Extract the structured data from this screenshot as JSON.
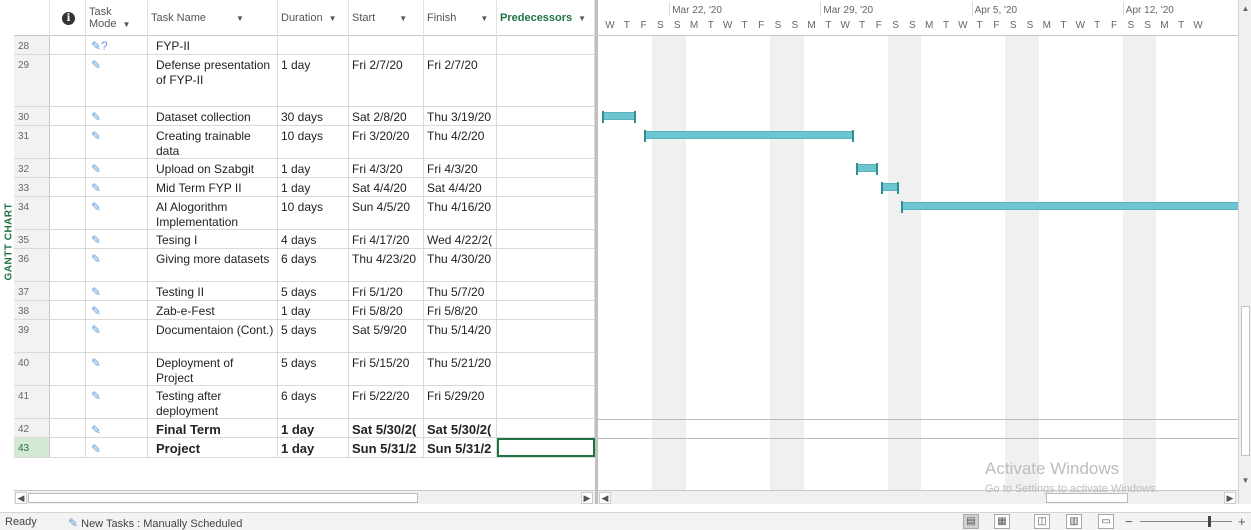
{
  "view": {
    "label": "GANTT CHART"
  },
  "columns": {
    "info_icon": "i",
    "mode_line1": "Task",
    "mode_line2": "Mode",
    "task_name": "Task Name",
    "duration": "Duration",
    "start": "Start",
    "finish": "Finish",
    "predecessors": "Predecessors"
  },
  "tasks": [
    {
      "id": "28",
      "name": "FYP-II",
      "duration": "",
      "start": "",
      "finish": "",
      "predecessors": ""
    },
    {
      "id": "29",
      "name": "Defense presentation of FYP-II",
      "duration": "1 day",
      "start": "Fri 2/7/20",
      "finish": "Fri 2/7/20",
      "predecessors": ""
    },
    {
      "id": "30",
      "name": "Dataset collection",
      "duration": "30 days",
      "start": "Sat 2/8/20",
      "finish": "Thu 3/19/20",
      "predecessors": ""
    },
    {
      "id": "31",
      "name": "Creating trainable data",
      "duration": "10 days",
      "start": "Fri 3/20/20",
      "finish": "Thu 4/2/20",
      "predecessors": ""
    },
    {
      "id": "32",
      "name": "Upload on Szabgit",
      "duration": "1 day",
      "start": "Fri 4/3/20",
      "finish": "Fri 4/3/20",
      "predecessors": ""
    },
    {
      "id": "33",
      "name": "Mid Term FYP II",
      "duration": "1 day",
      "start": "Sat 4/4/20",
      "finish": "Sat 4/4/20",
      "predecessors": ""
    },
    {
      "id": "34",
      "name": "AI Alogorithm Implementation",
      "duration": "10 days",
      "start": "Sun 4/5/20",
      "finish": "Thu 4/16/20",
      "predecessors": ""
    },
    {
      "id": "35",
      "name": "Tesing I",
      "duration": "4 days",
      "start": "Fri 4/17/20",
      "finish": "Wed 4/22/2(",
      "predecessors": ""
    },
    {
      "id": "36",
      "name": "Giving more datasets",
      "duration": "6 days",
      "start": "Thu 4/23/20",
      "finish": "Thu 4/30/20",
      "predecessors": ""
    },
    {
      "id": "37",
      "name": "Testing II",
      "duration": "5 days",
      "start": "Fri 5/1/20",
      "finish": "Thu 5/7/20",
      "predecessors": ""
    },
    {
      "id": "38",
      "name": "Zab-e-Fest",
      "duration": "1 day",
      "start": "Fri 5/8/20",
      "finish": "Fri 5/8/20",
      "predecessors": ""
    },
    {
      "id": "39",
      "name": "Documentaion (Cont.)",
      "duration": "5 days",
      "start": "Sat 5/9/20",
      "finish": "Thu 5/14/20",
      "predecessors": ""
    },
    {
      "id": "40",
      "name": "Deployment of Project",
      "duration": "5 days",
      "start": "Fri 5/15/20",
      "finish": "Thu 5/21/20",
      "predecessors": ""
    },
    {
      "id": "41",
      "name": "Testing after deployment",
      "duration": "6 days",
      "start": "Fri 5/22/20",
      "finish": "Fri 5/29/20",
      "predecessors": ""
    },
    {
      "id": "42",
      "name": "Final Term",
      "duration": "1 day",
      "start": "Sat 5/30/2(",
      "finish": "Sat 5/30/2(",
      "predecessors": ""
    },
    {
      "id": "43",
      "name": "Project submission",
      "duration": "1 day",
      "start": "Sun 5/31/2",
      "finish": "Sun 5/31/2",
      "predecessors": ""
    }
  ],
  "timescale": {
    "weeks": [
      "Mar 22, '20",
      "Mar 29, '20",
      "Apr 5, '20",
      "Apr 12, '20"
    ],
    "days": [
      "W",
      "T",
      "F",
      "S",
      "S",
      "M",
      "T",
      "W",
      "T",
      "F",
      "S",
      "S",
      "M",
      "T",
      "W",
      "T",
      "F",
      "S",
      "S",
      "M",
      "T",
      "W",
      "T",
      "F",
      "S",
      "S",
      "M",
      "T",
      "W",
      "T",
      "F",
      "S",
      "S",
      "M",
      "T",
      "W"
    ]
  },
  "bar_color": "#6bc6cf",
  "watermark": {
    "title": "Activate Windows",
    "subtitle": "Go to Settings to activate Windows."
  },
  "statusbar": {
    "ready": "Ready",
    "new_tasks": "New Tasks : Manually Scheduled"
  }
}
